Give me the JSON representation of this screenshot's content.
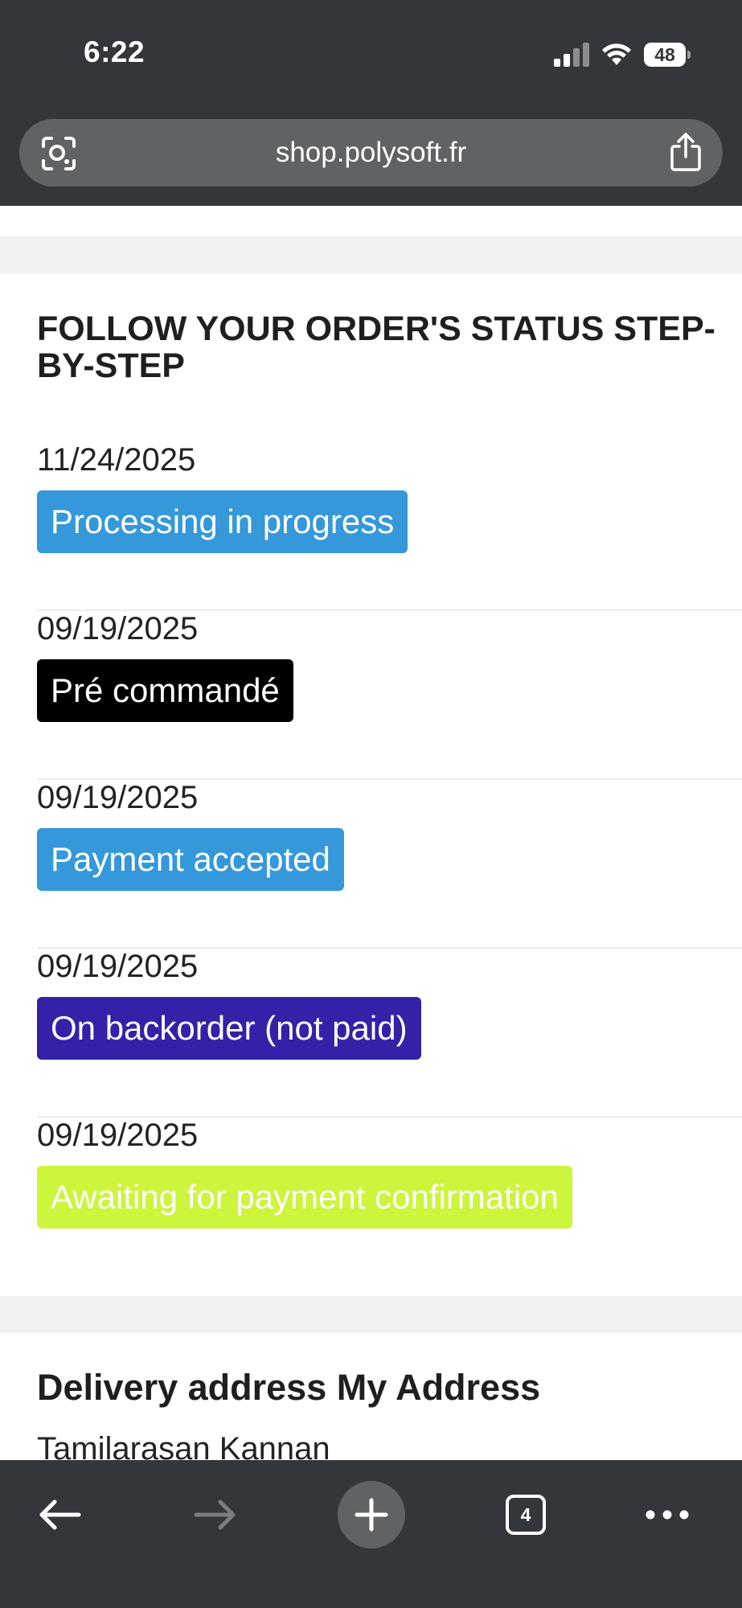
{
  "status_bar": {
    "time": "6:22",
    "battery": "48"
  },
  "browser": {
    "url": "shop.polysoft.fr",
    "tab_count": "4"
  },
  "order_status": {
    "title": "FOLLOW YOUR ORDER'S STATUS STEP-BY-STEP",
    "history": [
      {
        "date": "11/24/2025",
        "status": "Processing in progress",
        "color": "#3498db",
        "text_color": "#ffffff"
      },
      {
        "date": "09/19/2025",
        "status": "Pré commandé",
        "color": "#000000",
        "text_color": "#ffffff"
      },
      {
        "date": "09/19/2025",
        "status": "Payment accepted",
        "color": "#3498db",
        "text_color": "#ffffff"
      },
      {
        "date": "09/19/2025",
        "status": "On backorder (not paid)",
        "color": "#3322a8",
        "text_color": "#ffffff"
      },
      {
        "date": "09/19/2025",
        "status": "Awaiting for payment confirmation",
        "color": "#ccf53c",
        "text_color": "#ffffff"
      }
    ]
  },
  "delivery": {
    "title": "Delivery address My Address",
    "name": "Tamilarasan Kannan"
  }
}
